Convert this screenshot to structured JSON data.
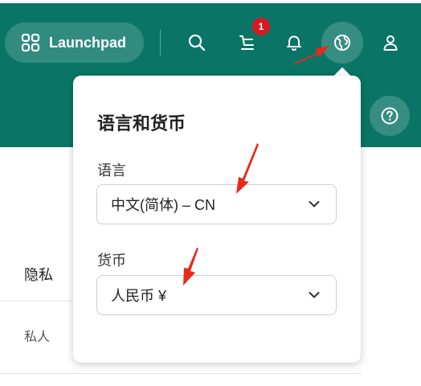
{
  "header": {
    "launchpad_label": "Launchpad",
    "cart_badge_count": "1",
    "icons": {
      "launchpad": "grid-icon",
      "search": "search-icon",
      "cart": "cart-icon",
      "notifications": "bell-icon",
      "language": "globe-icon",
      "account": "user-icon",
      "help": "help-icon"
    }
  },
  "popover": {
    "title": "语言和货币",
    "language": {
      "label": "语言",
      "selected": "中文(简体) – CN"
    },
    "currency": {
      "label": "货币",
      "selected": "人民币 ¥"
    }
  },
  "table": {
    "column_header": "隐私",
    "row_value": "私人"
  },
  "colors": {
    "header_bg": "#0a7566",
    "badge": "#d71920",
    "annotation_arrow": "#e8291c"
  }
}
